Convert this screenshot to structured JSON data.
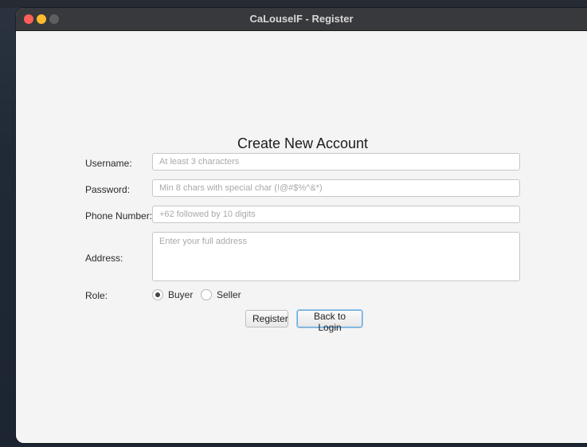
{
  "window": {
    "title": "CaLouselF - Register"
  },
  "form": {
    "heading": "Create New Account",
    "username": {
      "label": "Username:",
      "placeholder": "At least 3 characters",
      "value": ""
    },
    "password": {
      "label": "Password:",
      "placeholder": "Min 8 chars with special char (!@#$%^&*)",
      "value": ""
    },
    "phone": {
      "label": "Phone Number:",
      "placeholder": "+62 followed by 10 digits",
      "value": ""
    },
    "address": {
      "label": "Address:",
      "placeholder": "Enter your full address",
      "value": ""
    },
    "role": {
      "label": "Role:",
      "options": [
        {
          "label": "Buyer",
          "selected": true
        },
        {
          "label": "Seller",
          "selected": false
        }
      ]
    }
  },
  "buttons": {
    "register": "Register",
    "back_to_login": "Back to Login"
  }
}
